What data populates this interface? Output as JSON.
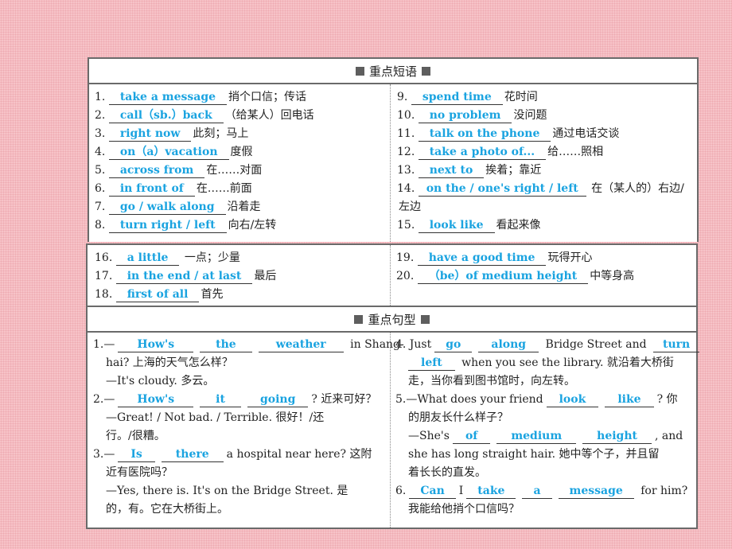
{
  "sections": {
    "phrases_title": "重点短语",
    "sentences_title": "重点句型"
  },
  "phrases": [
    {
      "num": "1.",
      "answer": "take a message",
      "meaning": "捎个口信；传话"
    },
    {
      "num": "2.",
      "answer": "call（sb.）back",
      "meaning": "（给某人）回电话"
    },
    {
      "num": "3.",
      "answer": "right now",
      "meaning": "此刻；马上"
    },
    {
      "num": "4.",
      "answer": "on（a）vacation",
      "meaning": "度假"
    },
    {
      "num": "5.",
      "answer": "across from",
      "meaning": "在……对面"
    },
    {
      "num": "6.",
      "answer": "in front of",
      "meaning": "在……前面"
    },
    {
      "num": "7.",
      "answer": "go / walk along",
      "meaning": "沿着走"
    },
    {
      "num": "8.",
      "answer": "turn right / left",
      "meaning": "向右/左转"
    },
    {
      "num": "9.",
      "answer": "spend time",
      "meaning": "花时间"
    },
    {
      "num": "10.",
      "answer": "no problem",
      "meaning": "没问题"
    },
    {
      "num": "11.",
      "answer": "talk on the phone",
      "meaning": "通过电话交谈"
    },
    {
      "num": "12.",
      "answer": "take a photo of...",
      "meaning": "给……照相"
    },
    {
      "num": "13.",
      "answer": "next to",
      "meaning": "挨着；靠近"
    },
    {
      "num": "14.",
      "answer": "on the / one's right / left",
      "meaning": "在（某人的）右边/",
      "meaning2": "左边"
    },
    {
      "num": "15.",
      "answer": "look like",
      "meaning": "看起来像"
    },
    {
      "num": "16.",
      "answer": "a little",
      "meaning": "一点；少量"
    },
    {
      "num": "17.",
      "answer": "in the end / at last",
      "meaning": "最后"
    },
    {
      "num": "18.",
      "answer": "first of all",
      "meaning": "首先"
    },
    {
      "num": "19.",
      "answer": "have a good time",
      "meaning": "玩得开心"
    },
    {
      "num": "20.",
      "answer": "（be）of medium height",
      "meaning": "中等身高"
    }
  ],
  "sentences": {
    "s1": {
      "num": "1.—",
      "blanks": [
        "How's",
        "the",
        "weather"
      ],
      "tail": "in Shang-",
      "line2": "hai? 上海的天气怎么样？",
      "line3": "—It's cloudy. 多云。"
    },
    "s2": {
      "num": "2.—",
      "blanks": [
        "How's",
        "it",
        "going"
      ],
      "tail": "? 近来可好？",
      "line2": "—Great! / Not bad. / Terrible. 很好！/还",
      "line3": "行。/很糟。"
    },
    "s3": {
      "num": "3.—",
      "blanks": [
        "Is",
        "there"
      ],
      "tail": "a hospital near here? 这附",
      "line2": "近有医院吗？",
      "line3": "—Yes, there is. It's on the Bridge Street. 是",
      "line4": "的，有。它在大桥街上。"
    },
    "s4": {
      "num": "4. Just",
      "blanks": [
        "go",
        "along",
        "turn",
        "left"
      ],
      "mid": "Bridge Street and",
      "tail": "when you see the library. 就沿着大桥街",
      "line3": "走，当你看到图书馆时，向左转。"
    },
    "s5": {
      "num": "5.—What does your friend",
      "blanks": [
        "look",
        "like",
        "of",
        "medium",
        "height"
      ],
      "tail": "? 你",
      "line2": "的朋友长什么样子？",
      "line3_pre": "—She's",
      "line3_tail": ", and",
      "line4": "she has long straight hair. 她中等个子，并且留",
      "line5": "着长长的直发。"
    },
    "s6": {
      "num": "6.",
      "blanks": [
        "Can",
        "take",
        "a",
        "message"
      ],
      "mid": "I",
      "tail": "for him?",
      "line2": "我能给他捎个口信吗？"
    }
  }
}
